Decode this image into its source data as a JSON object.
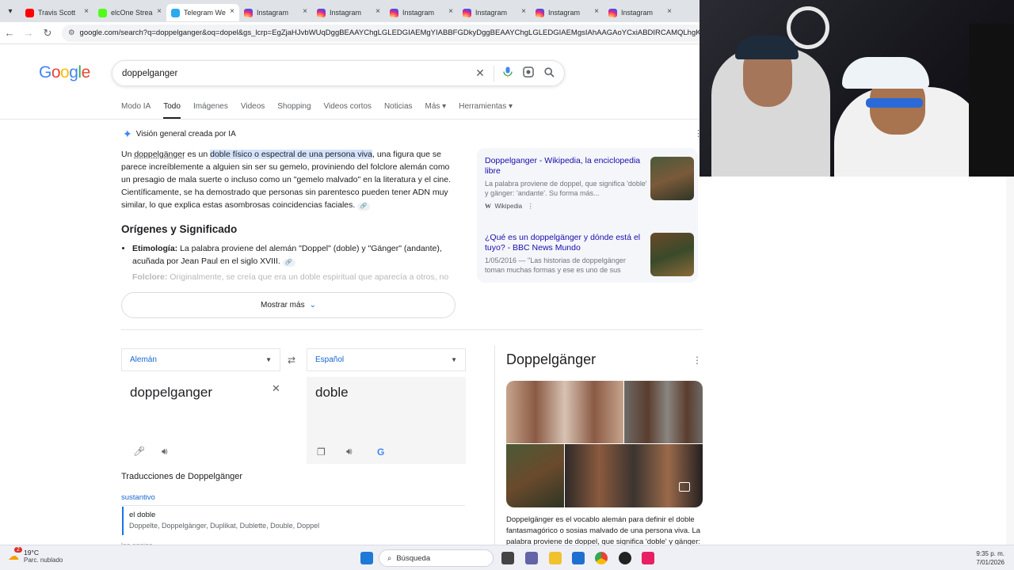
{
  "browser": {
    "tabs": [
      {
        "label": "Travis Scott",
        "favicon": "youtube-favicon",
        "color": "#ff0000"
      },
      {
        "label": "elcOne Strea",
        "favicon": "kick-favicon",
        "color": "#53fc18"
      },
      {
        "label": "Telegram We",
        "favicon": "telegram-favicon",
        "color": "#2aabee",
        "active": true
      },
      {
        "label": "Instagram",
        "favicon": "instagram-favicon"
      },
      {
        "label": "Instagram",
        "favicon": "instagram-favicon"
      },
      {
        "label": "Instagram",
        "favicon": "instagram-favicon"
      },
      {
        "label": "Instagram",
        "favicon": "instagram-favicon"
      },
      {
        "label": "Instagram",
        "favicon": "instagram-favicon"
      },
      {
        "label": "Instagram",
        "favicon": "instagram-favicon"
      }
    ],
    "url": "google.com/search?q=doppelganger&oq=dopel&gs_lcrp=EgZjaHJvbWUqDggBEAAYChgLGLEDGIAEMgYIABBFGDkyDggBEAAYChgLGLEDGIAEMgsIAhAAGAoYCxiABDIRCAMQLhgKGAsYxAEY"
  },
  "google": {
    "logo": "Google",
    "query": "doppelganger",
    "tabs": [
      "Modo IA",
      "Todo",
      "Imágenes",
      "Videos",
      "Shopping",
      "Videos cortos",
      "Noticias",
      "Más",
      "Herramientas"
    ]
  },
  "ai_overview": {
    "header": "Visión general creada por IA",
    "p_a": "Un ",
    "p_b": "doppelgänger",
    "p_c": " es un ",
    "p_highlight": "doble físico o espectral de una persona viva",
    "p_rest": ", una figura que se parece increíblemente a alguien sin ser su gemelo, proviniendo del folclore alemán como un presagio de mala suerte o incluso como un \"gemelo malvado\" en la literatura y el cine. Científicamente, se ha demostrado que personas sin parentesco pueden tener ADN muy similar, lo que explica estas asombrosas coincidencias faciales.",
    "section_title": "Orígenes y Significado",
    "bullet1_label": "Etimología:",
    "bullet1_text": " La palabra proviene del alemán \"Doppel\" (doble) y \"Gänger\" (andante), acuñada por Jean Paul en el siglo XVIII.",
    "bullet2_label": "Folclore:",
    "bullet2_text": " Originalmente, se creía que era un doble espiritual que aparecía a otros, no",
    "show_more": "Mostrar más",
    "sources": [
      {
        "title": "Doppelganger - Wikipedia, la enciclopedia libre",
        "desc": "La palabra proviene de doppel, que significa 'doble' y gänger: 'andante'. Su forma más...",
        "meta": "Wikipedia"
      },
      {
        "title": "¿Qué es un doppelgänger y dónde está el tuyo? - BBC News Mundo",
        "desc": "1/05/2016 — \"Las historias de doppelgänger toman muchas formas y ese es uno de sus",
        "meta": ""
      }
    ]
  },
  "translator": {
    "source_lang": "Alemán",
    "target_lang": "Español",
    "source_text": "doppelganger",
    "target_text": "doble",
    "translations_title": "Traducciones de Doppelgänger",
    "pos": "sustantivo",
    "entry_word": "el doble",
    "entry_synonyms": "Doppelte, Doppelgänger, Duplikat, Dublette, Double, Doppel",
    "next_entry": "los sosias"
  },
  "knowledge_panel": {
    "title": "Doppelgänger",
    "description": "Doppelgänger es el vocablo alemán para definir el doble fantasmagórico o sosias malvado de una persona viva. La palabra proviene de doppel, que significa 'doble' y gänger:"
  },
  "taskbar": {
    "temp": "19°C",
    "weather": "Parc. nublado",
    "weather_badge": "2",
    "search": "Búsqueda",
    "time": "9:35 p. m.",
    "date": "7/01/2026"
  },
  "colors": {
    "google_blue": "#4285f4",
    "google_red": "#ea4335",
    "google_yellow": "#fbbc05",
    "google_green": "#34a853",
    "link": "#1a0dab"
  }
}
